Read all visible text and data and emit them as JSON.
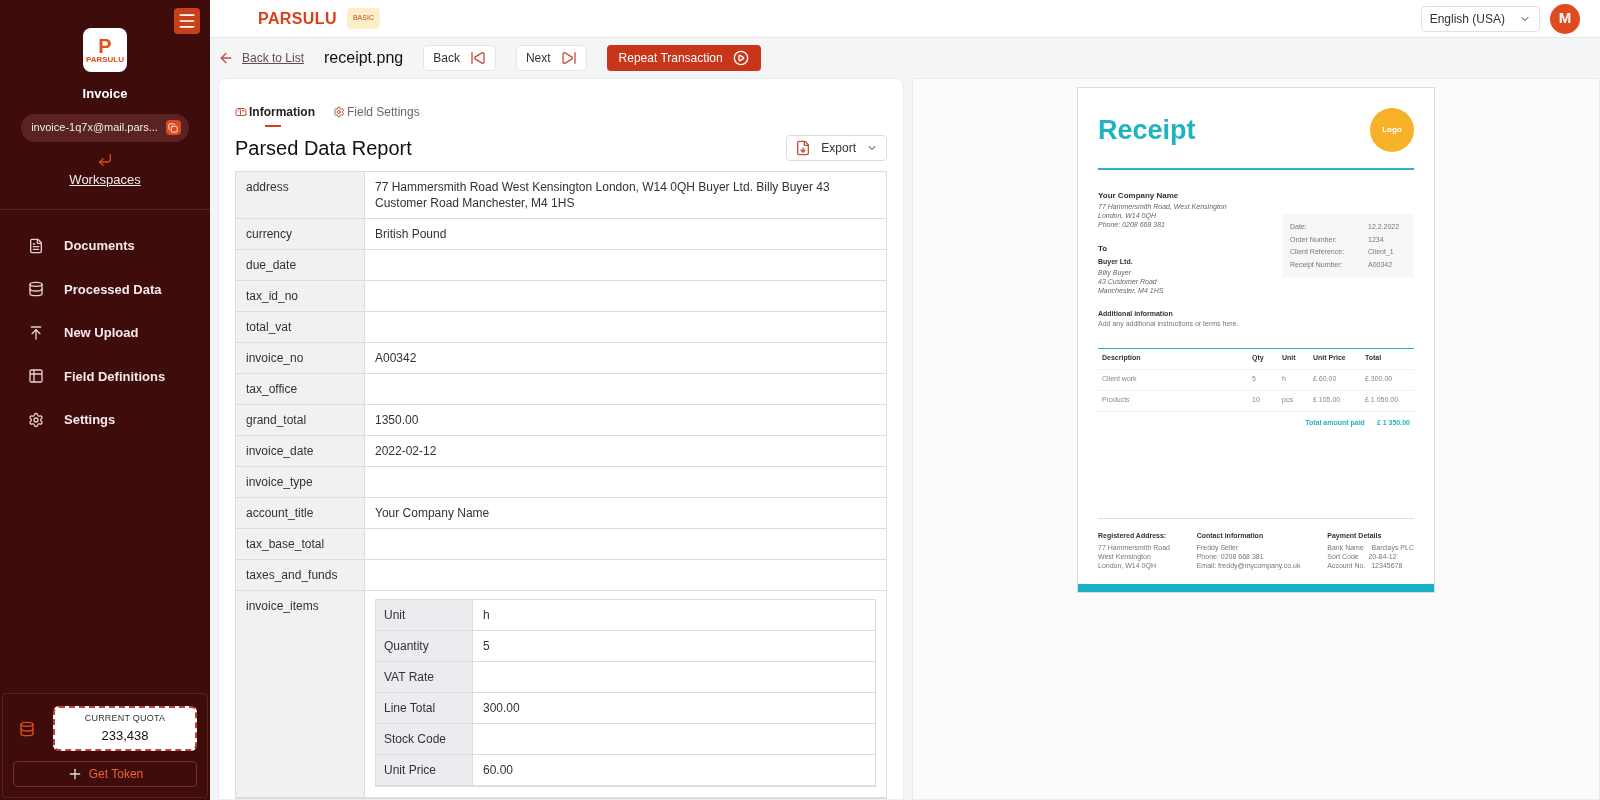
{
  "sidebar": {
    "logo_letter": "P",
    "logo_text": "PARSULU",
    "title": "Invoice",
    "email": "invoice-1q7x@mail.pars...",
    "workspaces": "Workspaces",
    "items": [
      {
        "kind": "file",
        "label": "Documents"
      },
      {
        "kind": "database",
        "label": "Processed Data"
      },
      {
        "kind": "upload",
        "label": "New Upload"
      },
      {
        "kind": "table",
        "label": "Field Definitions"
      },
      {
        "kind": "settings",
        "label": "Settings"
      }
    ],
    "quota": {
      "label": "CURRENT QUOTA",
      "value": "233,438"
    },
    "get_token": "Get Token"
  },
  "header": {
    "brand": "PARSULU",
    "plan": "BASIC",
    "language": "English (USA)",
    "avatar": "M"
  },
  "toolbar": {
    "back_to_list": "Back to List",
    "file_name": "receipt.png",
    "back": "Back",
    "next": "Next",
    "repeat": "Repeat Transaction"
  },
  "tabs": [
    {
      "kind": "info",
      "label": "Information",
      "selected": true
    },
    {
      "kind": "settings",
      "label": "Field Settings",
      "selected": false
    }
  ],
  "report": {
    "title": "Parsed Data Report",
    "export": "Export",
    "rows": [
      {
        "field": "address",
        "value": "77 Hammersmith Road West Kensington London, W14 0QH Buyer Ltd. Billy Buyer 43 Customer Road Manchester, M4 1HS"
      },
      {
        "field": "currency",
        "value": "British Pound"
      },
      {
        "field": "due_date",
        "value": ""
      },
      {
        "field": "tax_id_no",
        "value": ""
      },
      {
        "field": "total_vat",
        "value": ""
      },
      {
        "field": "invoice_no",
        "value": "A00342"
      },
      {
        "field": "tax_office",
        "value": ""
      },
      {
        "field": "grand_total",
        "value": "1350.00"
      },
      {
        "field": "invoice_date",
        "value": "2022-02-12"
      },
      {
        "field": "invoice_type",
        "value": ""
      },
      {
        "field": "account_title",
        "value": "Your Company Name"
      },
      {
        "field": "tax_base_total",
        "value": ""
      },
      {
        "field": "taxes_and_funds",
        "value": ""
      },
      {
        "field": "invoice_items",
        "items": [
          {
            "field": "Unit",
            "value": "h"
          },
          {
            "field": "Quantity",
            "value": "5"
          },
          {
            "field": "VAT Rate",
            "value": ""
          },
          {
            "field": "Line Total",
            "value": "300.00"
          },
          {
            "field": "Stock Code",
            "value": ""
          },
          {
            "field": "Unit Price",
            "value": "60.00"
          }
        ]
      }
    ]
  },
  "preview": {
    "title": "Receipt",
    "logo": "Logo",
    "company": "Your Company Name",
    "company_lines": [
      "77 Hammersmith Road, West Kensington",
      "London, W14 0QH",
      "Phone: 0208 668 381"
    ],
    "to_label": "To",
    "buyer": "Buyer Ltd.",
    "buyer_lines": [
      "Billy Buyer",
      "43 Customer Road",
      "Manchester, M4 1HS"
    ],
    "meta": [
      [
        "Date:",
        "12.2.2022"
      ],
      [
        "Order Number:",
        "1234"
      ],
      [
        "Client Reference:",
        "Client_1"
      ],
      [
        "Receipt Number:",
        "A00342"
      ]
    ],
    "additional_title": "Additional information",
    "additional_text": "Add any additional instructions or terms here.",
    "columns": [
      "Description",
      "Qty",
      "Unit",
      "Unit Price",
      "Total"
    ],
    "lines": [
      [
        "Client work",
        "5",
        "h",
        "£ 60.00",
        "£ 300.00"
      ],
      [
        "Products",
        "10",
        "pcs",
        "£ 105.00",
        "£ 1 050.00"
      ]
    ],
    "total_label": "Total amount paid",
    "total_value": "£ 1 350.00",
    "footer": [
      {
        "title": "Registered Address:",
        "lines": [
          "77 Hammersmith Road",
          "West Kensington",
          "London, W14 0QH"
        ]
      },
      {
        "title": "Contact information",
        "lines": [
          "Freddy Seller",
          "Phone: 0208 668 381",
          "Email: freddy@mycompany.co.uk"
        ]
      },
      {
        "title": "Payment Details",
        "lines": [
          "Bank Name    Barclays PLC",
          "Sort Code     20-84-12",
          "Account No.   12345678"
        ]
      }
    ]
  }
}
